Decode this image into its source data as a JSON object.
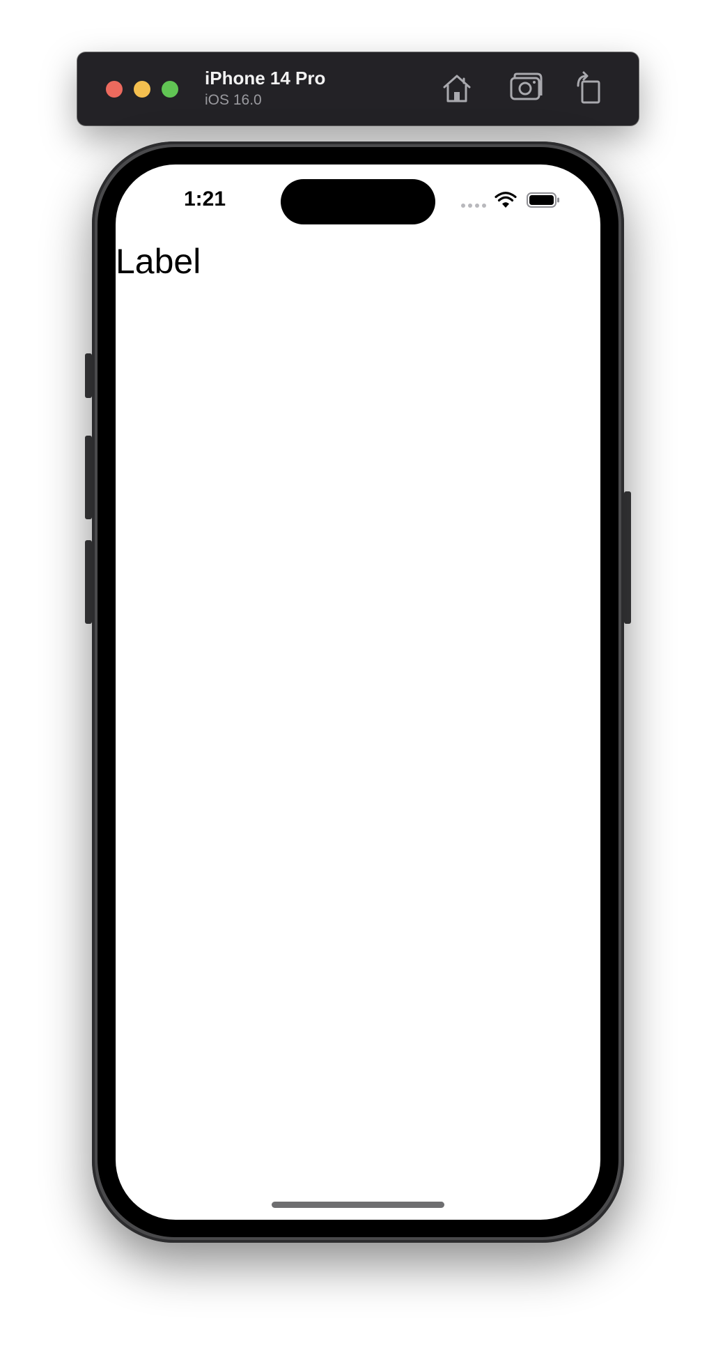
{
  "simulator": {
    "device_name": "iPhone 14 Pro",
    "os_version": "iOS 16.0",
    "toolbar": {
      "home_icon": "home-icon",
      "screenshot_icon": "camera-icon",
      "rotate_icon": "rotate-icon"
    }
  },
  "status_bar": {
    "time": "1:21",
    "signal_icon": "cellular-dots-icon",
    "wifi_icon": "wifi-icon",
    "battery_icon": "battery-icon"
  },
  "app": {
    "label": "Label"
  },
  "colors": {
    "simulator_bar": "#232226",
    "traffic_red": "#ec6a5e",
    "traffic_yellow": "#f4bf4f",
    "traffic_green": "#61c554",
    "screen_background": "#ffffff"
  }
}
